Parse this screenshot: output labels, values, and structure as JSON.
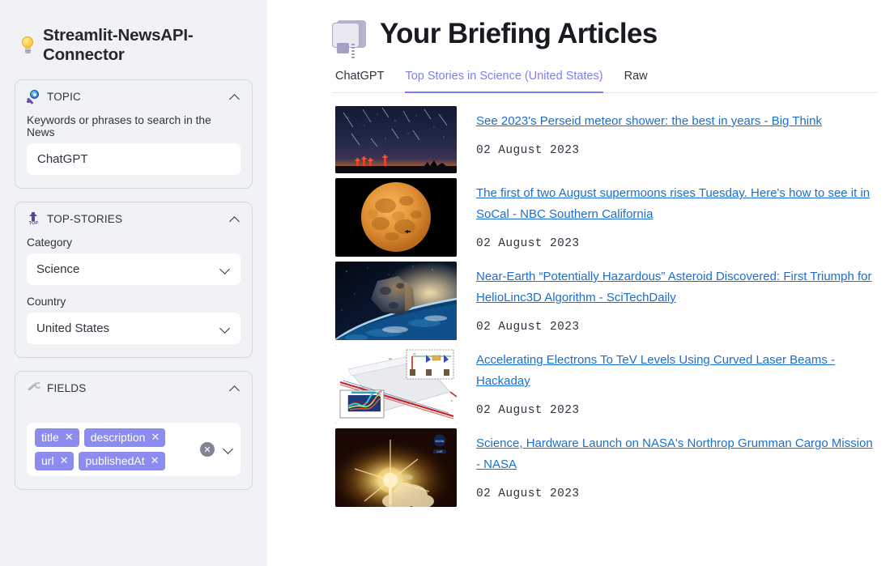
{
  "sidebar": {
    "app_title": "Streamlit-NewsAPI-Connector",
    "app_icon": "light-bulb-icon",
    "panels": [
      {
        "icon": "key-icon",
        "title": "TOPIC",
        "field_label": "Keywords or phrases to search in the News",
        "input_value": "ChatGPT",
        "input_placeholder": ""
      },
      {
        "icon": "top-arrow-icon",
        "title": "TOP-STORIES",
        "category_label": "Category",
        "category_value": "Science",
        "country_label": "Country",
        "country_value": "United States"
      },
      {
        "icon": "wrench-icon",
        "title": "FIELDS",
        "chips": [
          "title",
          "description",
          "url",
          "publishedAt"
        ]
      }
    ]
  },
  "main": {
    "title": "Your Briefing Articles",
    "title_icon": "newspaper-icon",
    "tabs": [
      {
        "label": "ChatGPT",
        "active": false
      },
      {
        "label": "Top Stories in Science (United States)",
        "active": true
      },
      {
        "label": "Raw",
        "active": false
      }
    ],
    "articles": [
      {
        "title": "See 2023's Perseid meteor shower: the best in years - Big Think",
        "date": "02 August 2023",
        "thumb": "meteor-shower-night-sky"
      },
      {
        "title": "The first of two August supermoons rises Tuesday. Here's how to see it in SoCal - NBC Southern California",
        "date": "02 August 2023",
        "thumb": "orange-supermoon"
      },
      {
        "title": "Near-Earth “Potentially Hazardous” Asteroid Discovered: First Triumph for HelioLinc3D Algorithm - SciTechDaily",
        "date": "02 August 2023",
        "thumb": "asteroid-over-earth"
      },
      {
        "title": "Accelerating Electrons To TeV Levels Using Curved Laser Beams - Hackaday",
        "date": "02 August 2023",
        "thumb": "laser-beam-diagram"
      },
      {
        "title": "Science, Hardware Launch on NASA's Northrop Grumman Cargo Mission - NASA",
        "date": "02 August 2023",
        "thumb": "rocket-night-launch"
      }
    ]
  },
  "colors": {
    "sidebar_bg": "#f0f2f6",
    "accent": "#7d7df2",
    "chip": "#8c8cf0",
    "link": "#1c6ecb",
    "text": "#31333f"
  }
}
